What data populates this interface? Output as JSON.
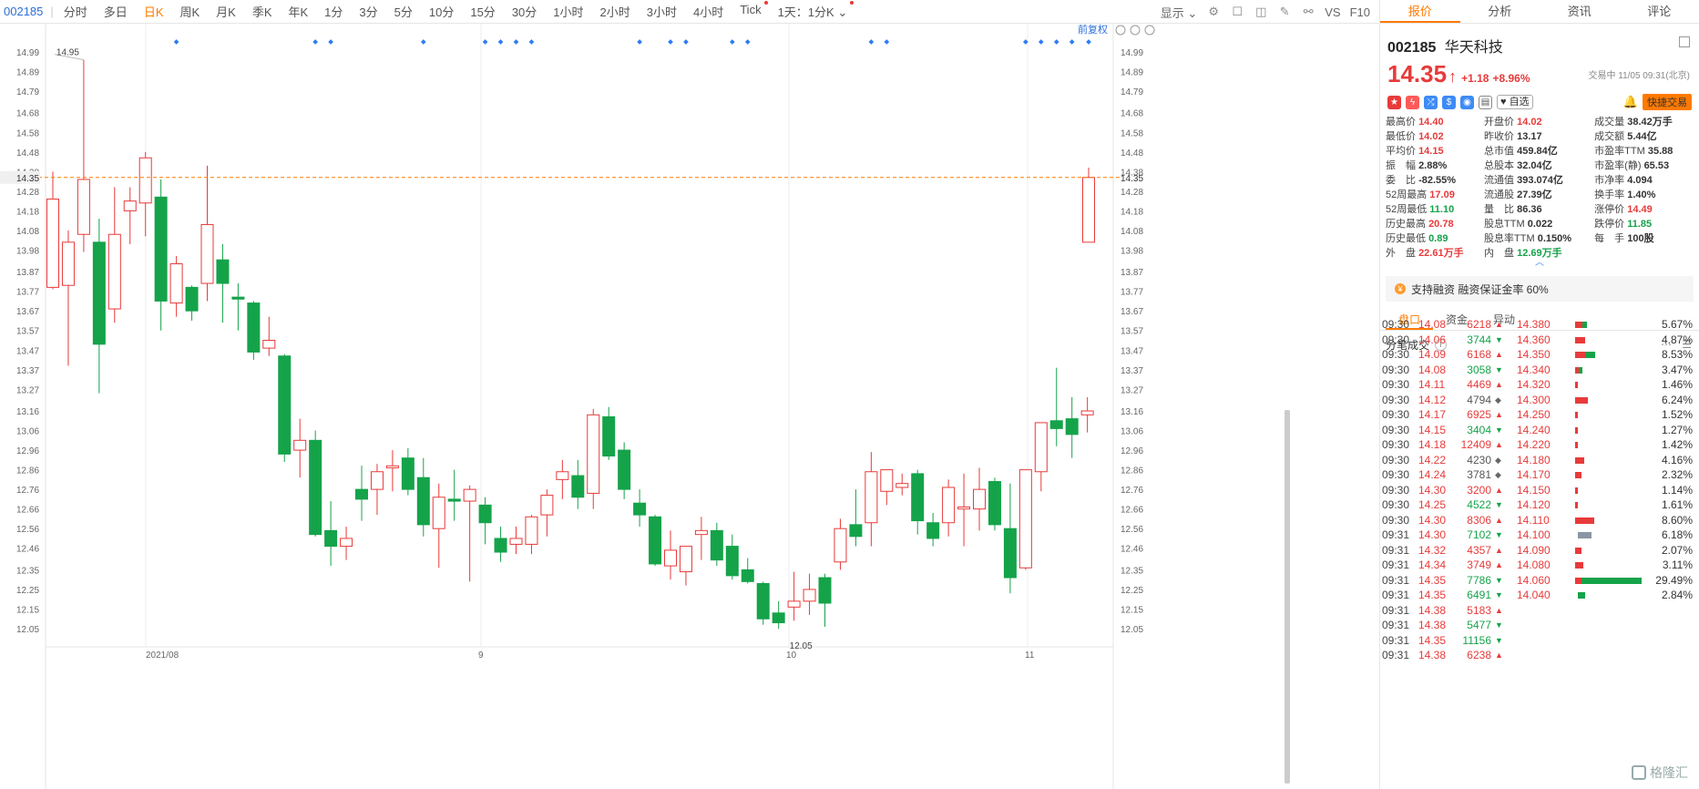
{
  "toolbar": {
    "code": "002185",
    "periods": [
      "分时",
      "多日",
      "日K",
      "周K",
      "月K",
      "季K",
      "年K",
      "1分",
      "3分",
      "5分",
      "10分",
      "15分",
      "30分",
      "1小时",
      "2小时",
      "3小时",
      "4小时",
      "Tick"
    ],
    "active_period": "日K",
    "range_select": "1天：1分K",
    "display_label": "显示",
    "vs_label": "VS",
    "f10_label": "F10"
  },
  "chart": {
    "adjust_label": "前复权",
    "max_label": "14.95",
    "min_label": "12.05",
    "current_price_label": "14.35",
    "x_labels": [
      "2021/08",
      "9",
      "10",
      "11"
    ],
    "price_axis_ticks": [
      "14.99",
      "14.89",
      "14.79",
      "14.68",
      "14.58",
      "14.48",
      "14.38",
      "14.28",
      "14.18",
      "14.08",
      "13.98",
      "13.87",
      "13.77",
      "13.67",
      "13.57",
      "13.47",
      "13.37",
      "13.27",
      "13.16",
      "13.06",
      "12.96",
      "12.86",
      "12.76",
      "12.66",
      "12.56",
      "12.46",
      "12.35",
      "12.25",
      "12.15",
      "12.05"
    ]
  },
  "chart_data": {
    "type": "candlestick",
    "y_range": [
      12.05,
      14.99
    ],
    "current_price": 14.35,
    "candles": [
      {
        "o": 13.79,
        "h": 14.38,
        "l": 13.78,
        "c": 14.24
      },
      {
        "o": 13.8,
        "h": 14.08,
        "l": 13.39,
        "c": 14.02
      },
      {
        "o": 14.06,
        "h": 14.95,
        "l": 13.97,
        "c": 14.34
      },
      {
        "o": 14.02,
        "h": 14.14,
        "l": 13.25,
        "c": 13.5
      },
      {
        "o": 13.68,
        "h": 14.3,
        "l": 13.61,
        "c": 14.06
      },
      {
        "o": 14.18,
        "h": 14.3,
        "l": 14.01,
        "c": 14.23
      },
      {
        "o": 14.22,
        "h": 14.48,
        "l": 14.05,
        "c": 14.45
      },
      {
        "o": 14.25,
        "h": 14.34,
        "l": 13.57,
        "c": 13.72
      },
      {
        "o": 13.71,
        "h": 13.95,
        "l": 13.64,
        "c": 13.91
      },
      {
        "o": 13.79,
        "h": 13.8,
        "l": 13.62,
        "c": 13.67
      },
      {
        "o": 13.81,
        "h": 14.41,
        "l": 13.72,
        "c": 14.11
      },
      {
        "o": 13.93,
        "h": 14.01,
        "l": 13.61,
        "c": 13.81
      },
      {
        "o": 13.74,
        "h": 13.81,
        "l": 13.57,
        "c": 13.73
      },
      {
        "o": 13.71,
        "h": 13.72,
        "l": 13.42,
        "c": 13.46
      },
      {
        "o": 13.48,
        "h": 13.64,
        "l": 13.44,
        "c": 13.52
      },
      {
        "o": 13.44,
        "h": 13.45,
        "l": 12.9,
        "c": 12.94
      },
      {
        "o": 12.96,
        "h": 13.12,
        "l": 12.82,
        "c": 13.01
      },
      {
        "o": 13.01,
        "h": 13.06,
        "l": 12.52,
        "c": 12.53
      },
      {
        "o": 12.55,
        "h": 12.7,
        "l": 12.37,
        "c": 12.47
      },
      {
        "o": 12.47,
        "h": 12.57,
        "l": 12.4,
        "c": 12.51
      },
      {
        "o": 12.76,
        "h": 12.88,
        "l": 12.6,
        "c": 12.71
      },
      {
        "o": 12.76,
        "h": 12.89,
        "l": 12.63,
        "c": 12.85
      },
      {
        "o": 12.87,
        "h": 12.96,
        "l": 12.75,
        "c": 12.88
      },
      {
        "o": 12.92,
        "h": 12.97,
        "l": 12.73,
        "c": 12.76
      },
      {
        "o": 12.82,
        "h": 12.92,
        "l": 12.52,
        "c": 12.58
      },
      {
        "o": 12.56,
        "h": 12.79,
        "l": 12.36,
        "c": 12.72
      },
      {
        "o": 12.71,
        "h": 12.86,
        "l": 12.6,
        "c": 12.7
      },
      {
        "o": 12.7,
        "h": 12.78,
        "l": 12.29,
        "c": 12.76
      },
      {
        "o": 12.68,
        "h": 12.72,
        "l": 12.48,
        "c": 12.59
      },
      {
        "o": 12.51,
        "h": 12.57,
        "l": 12.39,
        "c": 12.44
      },
      {
        "o": 12.48,
        "h": 12.57,
        "l": 12.43,
        "c": 12.51
      },
      {
        "o": 12.48,
        "h": 12.63,
        "l": 12.43,
        "c": 12.62
      },
      {
        "o": 12.63,
        "h": 12.76,
        "l": 12.52,
        "c": 12.73
      },
      {
        "o": 12.81,
        "h": 12.91,
        "l": 12.71,
        "c": 12.85
      },
      {
        "o": 12.83,
        "h": 12.91,
        "l": 12.66,
        "c": 12.72
      },
      {
        "o": 12.74,
        "h": 13.17,
        "l": 12.66,
        "c": 13.14
      },
      {
        "o": 13.13,
        "h": 13.18,
        "l": 12.91,
        "c": 12.93
      },
      {
        "o": 12.96,
        "h": 13.0,
        "l": 12.71,
        "c": 12.76
      },
      {
        "o": 12.69,
        "h": 12.76,
        "l": 12.57,
        "c": 12.63
      },
      {
        "o": 12.62,
        "h": 12.63,
        "l": 12.37,
        "c": 12.38
      },
      {
        "o": 12.37,
        "h": 12.55,
        "l": 12.3,
        "c": 12.45
      },
      {
        "o": 12.34,
        "h": 12.42,
        "l": 12.27,
        "c": 12.47
      },
      {
        "o": 12.53,
        "h": 12.62,
        "l": 12.4,
        "c": 12.55
      },
      {
        "o": 12.55,
        "h": 12.59,
        "l": 12.37,
        "c": 12.4
      },
      {
        "o": 12.47,
        "h": 12.53,
        "l": 12.3,
        "c": 12.32
      },
      {
        "o": 12.35,
        "h": 12.41,
        "l": 12.28,
        "c": 12.29
      },
      {
        "o": 12.28,
        "h": 12.29,
        "l": 12.07,
        "c": 12.1
      },
      {
        "o": 12.13,
        "h": 12.19,
        "l": 12.05,
        "c": 12.08
      },
      {
        "o": 12.16,
        "h": 12.34,
        "l": 12.09,
        "c": 12.19
      },
      {
        "o": 12.19,
        "h": 12.33,
        "l": 12.12,
        "c": 12.25
      },
      {
        "o": 12.31,
        "h": 12.33,
        "l": 12.06,
        "c": 12.18
      },
      {
        "o": 12.39,
        "h": 12.61,
        "l": 12.35,
        "c": 12.56
      },
      {
        "o": 12.58,
        "h": 12.76,
        "l": 12.47,
        "c": 12.52
      },
      {
        "o": 12.59,
        "h": 12.95,
        "l": 12.47,
        "c": 12.85
      },
      {
        "o": 12.75,
        "h": 12.86,
        "l": 12.68,
        "c": 12.86
      },
      {
        "o": 12.77,
        "h": 12.84,
        "l": 12.73,
        "c": 12.79
      },
      {
        "o": 12.84,
        "h": 12.86,
        "l": 12.53,
        "c": 12.6
      },
      {
        "o": 12.59,
        "h": 12.64,
        "l": 12.47,
        "c": 12.51
      },
      {
        "o": 12.59,
        "h": 12.81,
        "l": 12.52,
        "c": 12.77
      },
      {
        "o": 12.66,
        "h": 12.84,
        "l": 12.47,
        "c": 12.67
      },
      {
        "o": 12.66,
        "h": 12.87,
        "l": 12.55,
        "c": 12.76
      },
      {
        "o": 12.8,
        "h": 12.82,
        "l": 12.55,
        "c": 12.58
      },
      {
        "o": 12.56,
        "h": 12.79,
        "l": 12.23,
        "c": 12.31
      },
      {
        "o": 12.36,
        "h": 12.76,
        "l": 12.35,
        "c": 12.86
      },
      {
        "o": 12.85,
        "h": 13.07,
        "l": 12.75,
        "c": 13.1
      },
      {
        "o": 13.11,
        "h": 13.38,
        "l": 12.98,
        "c": 13.07
      },
      {
        "o": 13.12,
        "h": 13.23,
        "l": 12.92,
        "c": 13.04
      },
      {
        "o": 13.14,
        "h": 13.23,
        "l": 13.05,
        "c": 13.16
      },
      {
        "o": 14.02,
        "h": 14.4,
        "l": 14.02,
        "c": 14.35
      }
    ],
    "marker_dots": [
      8,
      17,
      18,
      24,
      28,
      29,
      30,
      31,
      38,
      40,
      41,
      44,
      45,
      53,
      54,
      63,
      64,
      65,
      66,
      68,
      69,
      70,
      71
    ]
  },
  "panel": {
    "tabs": [
      "报价",
      "分析",
      "资讯",
      "评论"
    ],
    "active_tab": "报价",
    "code": "002185",
    "name": "华天科技",
    "price": "14.35",
    "arrow": "↑",
    "change": "+1.18",
    "change_pct": "+8.96%",
    "status": "交易中 11/05 09:31(北京)",
    "watch_label": "自选",
    "quick_trade_label": "快捷交易",
    "quote_rows": [
      [
        [
          "最高价",
          "14.40",
          "up"
        ],
        [
          "开盘价",
          "14.02",
          "up"
        ],
        [
          "成交量",
          "38.42万手",
          ""
        ]
      ],
      [
        [
          "最低价",
          "14.02",
          "up"
        ],
        [
          "昨收价",
          "13.17",
          ""
        ],
        [
          "成交额",
          "5.44亿",
          ""
        ]
      ],
      [
        [
          "平均价",
          "14.15",
          "up"
        ],
        [
          "总市值",
          "459.84亿",
          ""
        ],
        [
          "市盈率TTM",
          "35.88",
          ""
        ]
      ],
      [
        [
          "振　幅",
          "2.88%",
          ""
        ],
        [
          "总股本",
          "32.04亿",
          ""
        ],
        [
          "市盈率(静)",
          "65.53",
          ""
        ]
      ],
      [
        [
          "委　比",
          "-82.55%",
          ""
        ],
        [
          "流通值",
          "393.074亿",
          ""
        ],
        [
          "市净率",
          "4.094",
          ""
        ]
      ],
      [
        [
          "52周最高",
          "17.09",
          "up"
        ],
        [
          "流通股",
          "27.39亿",
          ""
        ],
        [
          "换手率",
          "1.40%",
          ""
        ]
      ],
      [
        [
          "52周最低",
          "11.10",
          "dn"
        ],
        [
          "量　比",
          "86.36",
          ""
        ],
        [
          "涨停价",
          "14.49",
          "up"
        ]
      ],
      [
        [
          "历史最高",
          "20.78",
          "up"
        ],
        [
          "股息TTM",
          "0.022",
          ""
        ],
        [
          "跌停价",
          "11.85",
          "dn"
        ]
      ],
      [
        [
          "历史最低",
          "0.89",
          "dn"
        ],
        [
          "股息率TTM",
          "0.150%",
          ""
        ],
        [
          "每　手",
          "100股",
          ""
        ]
      ],
      [
        [
          "外　盘",
          "22.61万手",
          "up"
        ],
        [
          "内　盘",
          "12.69万手",
          "dn"
        ],
        [
          "",
          "",
          " "
        ]
      ]
    ],
    "margin_text": "支持融资 融资保证金率 60%",
    "subtabs": [
      "盘口",
      "资金",
      "异动"
    ],
    "active_subtab": "盘口",
    "trades_title": "分笔成交",
    "trades": [
      [
        "09:30",
        "14.08",
        "6218",
        "up",
        "14.380",
        "5.67%"
      ],
      [
        "09:30",
        "14.06",
        "3744",
        "dn",
        "14.360",
        "4.87%"
      ],
      [
        "09:30",
        "14.09",
        "6168",
        "up",
        "14.350",
        "8.53%"
      ],
      [
        "09:30",
        "14.08",
        "3058",
        "dn",
        "14.340",
        "3.47%"
      ],
      [
        "09:30",
        "14.11",
        "4469",
        "up",
        "14.320",
        "1.46%"
      ],
      [
        "09:30",
        "14.12",
        "4794",
        "mid",
        "14.300",
        "6.24%"
      ],
      [
        "09:30",
        "14.17",
        "6925",
        "up",
        "14.250",
        "1.52%"
      ],
      [
        "09:30",
        "14.15",
        "3404",
        "dn",
        "14.240",
        "1.27%"
      ],
      [
        "09:30",
        "14.18",
        "12409",
        "up",
        "14.220",
        "1.42%"
      ],
      [
        "09:30",
        "14.22",
        "4230",
        "mid",
        "14.180",
        "4.16%"
      ],
      [
        "09:30",
        "14.24",
        "3781",
        "mid",
        "14.170",
        "2.32%"
      ],
      [
        "09:30",
        "14.30",
        "3200",
        "up",
        "14.150",
        "1.14%"
      ],
      [
        "09:30",
        "14.25",
        "4522",
        "dn",
        "14.120",
        "1.61%"
      ],
      [
        "09:30",
        "14.30",
        "8306",
        "up",
        "14.110",
        "8.60%"
      ],
      [
        "09:31",
        "14.30",
        "7102",
        "dn",
        "14.100",
        "6.18%"
      ],
      [
        "09:31",
        "14.32",
        "4357",
        "up",
        "14.090",
        "2.07%"
      ],
      [
        "09:31",
        "14.34",
        "3749",
        "up",
        "14.080",
        "3.11%"
      ],
      [
        "09:31",
        "14.35",
        "7786",
        "dn",
        "14.060",
        "29.49%"
      ],
      [
        "09:31",
        "14.35",
        "6491",
        "dn",
        "14.040",
        "2.84%"
      ],
      [
        "09:31",
        "14.38",
        "5183",
        "up",
        "",
        ""
      ],
      [
        "09:31",
        "14.38",
        "5477",
        "dn",
        "",
        ""
      ],
      [
        "09:31",
        "14.35",
        "11156",
        "dn",
        "",
        ""
      ],
      [
        "09:31",
        "14.38",
        "6238",
        "up",
        "",
        ""
      ]
    ],
    "trades_bars": [
      {
        "r": 0.35,
        "g": 0.25
      },
      {
        "r": 0.5,
        "g": 0
      },
      {
        "r": 0.55,
        "g": 0.45
      },
      {
        "r": 0.2,
        "g": 0.15
      },
      {
        "r": 0.15,
        "g": 0
      },
      {
        "r": 0.65,
        "g": 0
      },
      {
        "r": 0.12,
        "g": 0
      },
      {
        "r": 0.08,
        "g": 0
      },
      {
        "r": 0.08,
        "g": 0
      },
      {
        "r": 0.45,
        "g": 0
      },
      {
        "r": 0.3,
        "g": 0
      },
      {
        "r": 0.12,
        "g": 0
      },
      {
        "r": 0.12,
        "g": 0
      },
      {
        "r": 0.95,
        "g": 0
      },
      {
        "r": 0,
        "g": 0.7,
        "gray": true
      },
      {
        "r": 0.3,
        "g": 0
      },
      {
        "r": 0.4,
        "g": 0
      },
      {
        "r": 0.3,
        "g": 3.0
      },
      {
        "r": 0,
        "g": 0.35
      }
    ],
    "watermark": "格隆汇"
  },
  "colors": {
    "up": "#e83a3a",
    "down": "#15a34a",
    "accent": "#ff7a00",
    "current_line": "#ff7a00",
    "marker": "#2e7cf6"
  }
}
